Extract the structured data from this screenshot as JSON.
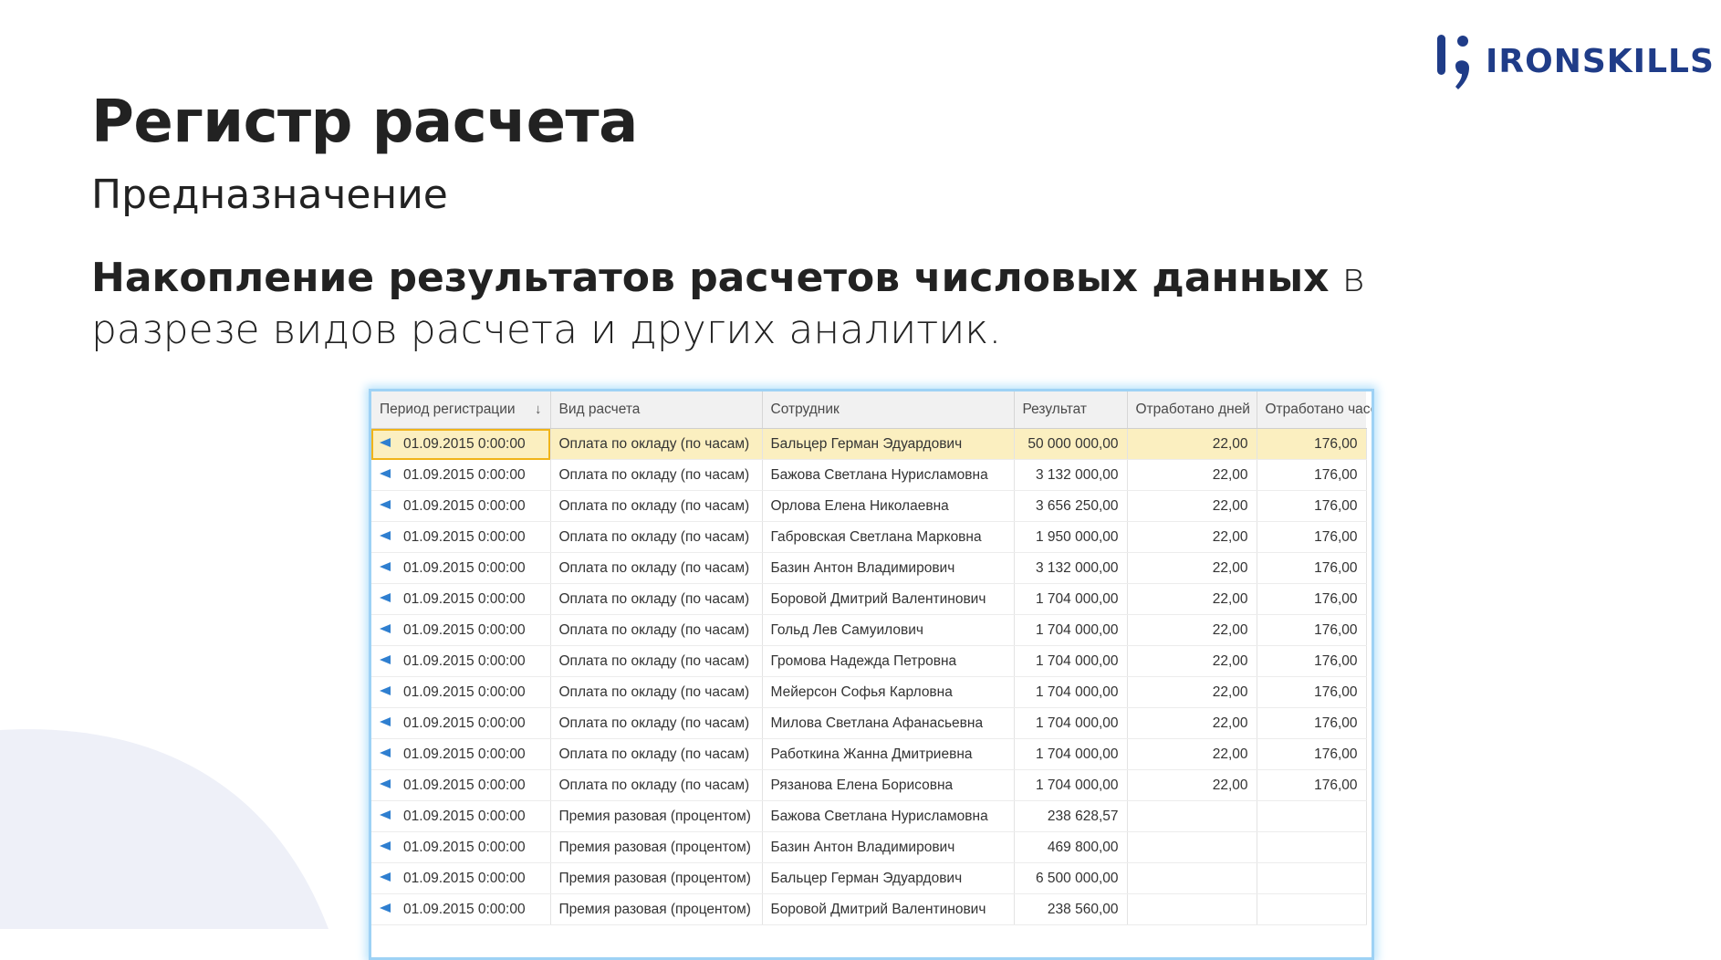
{
  "logo": {
    "text": "IRONSKILLS"
  },
  "title": "Регистр расчета",
  "subtitle": "Предназначение",
  "description": {
    "bold": "Накопление результатов расчетов числовых данных",
    "rest": " в разрезе видов расчета и других аналитик."
  },
  "colors": {
    "brand": "#1f3c88",
    "accent_blob": "#eef0f8",
    "selection": "#fbefc0",
    "border": "#9ed2f5"
  },
  "table": {
    "columns": [
      "Период регистрации",
      "Вид расчета",
      "Сотрудник",
      "Результат",
      "Отработано дней",
      "Отработано часов"
    ],
    "sort_icon": "sort-down-icon",
    "row_icon": "record-arrow-icon",
    "rows": [
      {
        "period": "01.09.2015 0:00:00",
        "type": "Оплата по окладу (по часам)",
        "employee": "Бальцер Герман Эдуардович",
        "result": "50 000 000,00",
        "days": "22,00",
        "hours": "176,00"
      },
      {
        "period": "01.09.2015 0:00:00",
        "type": "Оплата по окладу (по часам)",
        "employee": "Бажова Светлана Нурисламовна",
        "result": "3 132 000,00",
        "days": "22,00",
        "hours": "176,00"
      },
      {
        "period": "01.09.2015 0:00:00",
        "type": "Оплата по окладу (по часам)",
        "employee": "Орлова Елена Николаевна",
        "result": "3 656 250,00",
        "days": "22,00",
        "hours": "176,00"
      },
      {
        "period": "01.09.2015 0:00:00",
        "type": "Оплата по окладу (по часам)",
        "employee": "Габровская Светлана Марковна",
        "result": "1 950 000,00",
        "days": "22,00",
        "hours": "176,00"
      },
      {
        "period": "01.09.2015 0:00:00",
        "type": "Оплата по окладу (по часам)",
        "employee": "Базин Антон Владимирович",
        "result": "3 132 000,00",
        "days": "22,00",
        "hours": "176,00"
      },
      {
        "period": "01.09.2015 0:00:00",
        "type": "Оплата по окладу (по часам)",
        "employee": "Боровой Дмитрий Валентинович",
        "result": "1 704 000,00",
        "days": "22,00",
        "hours": "176,00"
      },
      {
        "period": "01.09.2015 0:00:00",
        "type": "Оплата по окладу (по часам)",
        "employee": "Гольд Лев Самуилович",
        "result": "1 704 000,00",
        "days": "22,00",
        "hours": "176,00"
      },
      {
        "period": "01.09.2015 0:00:00",
        "type": "Оплата по окладу (по часам)",
        "employee": "Громова Надежда Петровна",
        "result": "1 704 000,00",
        "days": "22,00",
        "hours": "176,00"
      },
      {
        "period": "01.09.2015 0:00:00",
        "type": "Оплата по окладу (по часам)",
        "employee": "Мейерсон Софья Карловна",
        "result": "1 704 000,00",
        "days": "22,00",
        "hours": "176,00"
      },
      {
        "period": "01.09.2015 0:00:00",
        "type": "Оплата по окладу (по часам)",
        "employee": "Милова Светлана Афанасьевна",
        "result": "1 704 000,00",
        "days": "22,00",
        "hours": "176,00"
      },
      {
        "period": "01.09.2015 0:00:00",
        "type": "Оплата по окладу (по часам)",
        "employee": "Работкина Жанна Дмитриевна",
        "result": "1 704 000,00",
        "days": "22,00",
        "hours": "176,00"
      },
      {
        "period": "01.09.2015 0:00:00",
        "type": "Оплата по окладу (по часам)",
        "employee": "Рязанова Елена Борисовна",
        "result": "1 704 000,00",
        "days": "22,00",
        "hours": "176,00"
      },
      {
        "period": "01.09.2015 0:00:00",
        "type": "Премия разовая (процентом)",
        "employee": "Бажова Светлана Нурисламовна",
        "result": "238 628,57",
        "days": "",
        "hours": ""
      },
      {
        "period": "01.09.2015 0:00:00",
        "type": "Премия разовая (процентом)",
        "employee": "Базин Антон Владимирович",
        "result": "469 800,00",
        "days": "",
        "hours": ""
      },
      {
        "period": "01.09.2015 0:00:00",
        "type": "Премия разовая (процентом)",
        "employee": "Бальцер Герман Эдуардович",
        "result": "6 500 000,00",
        "days": "",
        "hours": ""
      },
      {
        "period": "01.09.2015 0:00:00",
        "type": "Премия разовая (процентом)",
        "employee": "Боровой Дмитрий Валентинович",
        "result": "238 560,00",
        "days": "",
        "hours": ""
      }
    ]
  }
}
